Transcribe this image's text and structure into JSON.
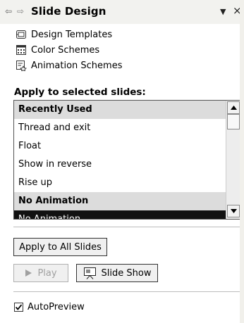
{
  "header": {
    "title": "Slide Design",
    "back_glyph": "⇦",
    "forward_glyph": "⇨",
    "menu_glyph": "▼",
    "close_glyph": "×"
  },
  "links": [
    {
      "label": "Design Templates",
      "icon": "design-templates-icon"
    },
    {
      "label": "Color Schemes",
      "icon": "color-schemes-icon"
    },
    {
      "label": "Animation Schemes",
      "icon": "animation-schemes-icon"
    }
  ],
  "apply_label": "Apply to selected slides:",
  "animation_list": {
    "items": [
      {
        "label": "Recently Used",
        "kind": "group"
      },
      {
        "label": "Thread and exit",
        "kind": "item"
      },
      {
        "label": "Float",
        "kind": "item"
      },
      {
        "label": "Show in reverse",
        "kind": "item"
      },
      {
        "label": "Rise up",
        "kind": "item"
      },
      {
        "label": "No Animation",
        "kind": "group"
      },
      {
        "label": "No Animation",
        "kind": "selected"
      }
    ]
  },
  "buttons": {
    "apply_all": "Apply to All Slides",
    "play": "Play",
    "slide_show": "Slide Show"
  },
  "autopreview": {
    "label": "AutoPreview",
    "checked": true
  },
  "colors": {
    "header_bg": "#f2f2ef",
    "group_bg": "#dcdcdc",
    "selected_bg": "#111111"
  }
}
